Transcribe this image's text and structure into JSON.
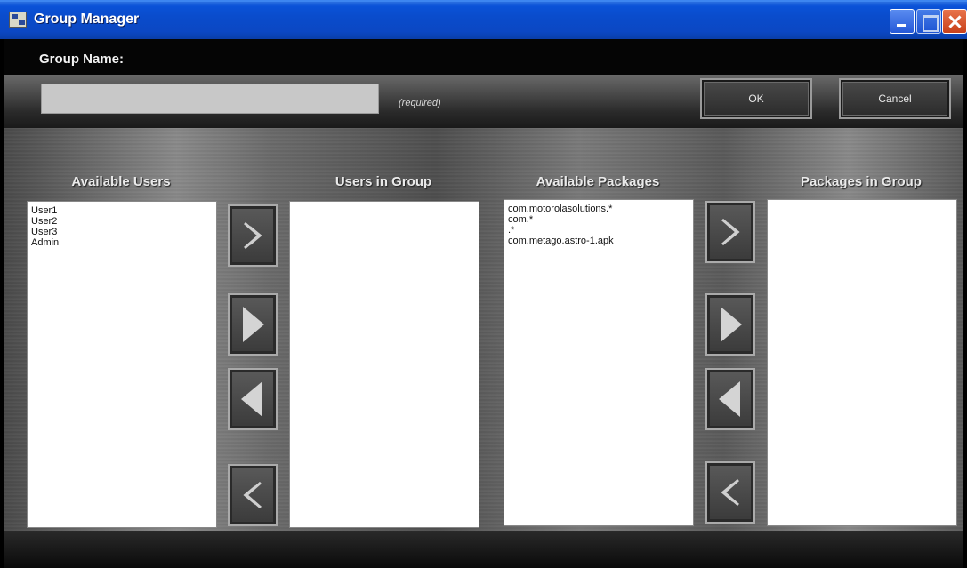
{
  "window": {
    "title": "Group Manager"
  },
  "header": {
    "group_name_label": "Group Name:",
    "group_name_value": "",
    "required_note": "(required)",
    "ok_label": "OK",
    "cancel_label": "Cancel"
  },
  "columns": {
    "available_users": "Available Users",
    "users_in_group": "Users in Group",
    "available_packages": "Available Packages",
    "packages_in_group": "Packages in Group"
  },
  "available_users": [
    "User1",
    "User2",
    "User3",
    "Admin"
  ],
  "users_in_group": [],
  "available_packages": [
    "com.motorolasolutions.*",
    "com.*",
    ".*",
    "com.metago.astro-1.apk"
  ],
  "packages_in_group": [],
  "icons": {
    "add_all": "double-chevron-right-icon",
    "add_selected": "triangle-right-icon",
    "remove_selected": "triangle-left-icon",
    "remove_all": "double-chevron-left-icon"
  },
  "colors": {
    "titlebar": "#0a4ccc",
    "listbox_bg": "#ffffff",
    "input_bg": "#c8c8c8"
  }
}
